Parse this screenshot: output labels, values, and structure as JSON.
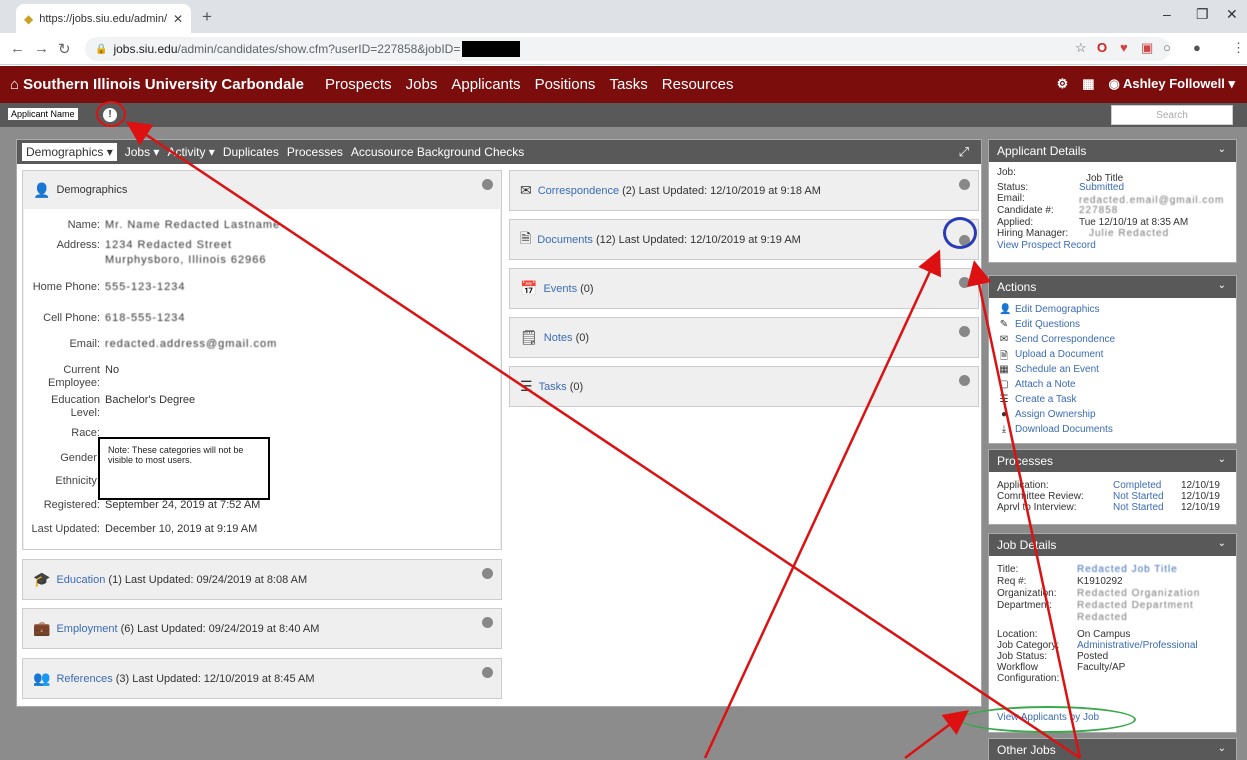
{
  "browser": {
    "tab_title": "https://jobs.siu.edu/admin/candi",
    "url_host": "jobs.siu.edu",
    "url_path": "/admin/candidates/show.cfm?userID=227858&jobID="
  },
  "site": {
    "brand": "Southern Illinois University Carbondale",
    "nav": [
      "Prospects",
      "Jobs",
      "Applicants",
      "Positions",
      "Tasks",
      "Resources"
    ],
    "user": "Ashley Followell"
  },
  "subbar": {
    "applicant_name": "Applicant Name",
    "search_placeholder": "Search"
  },
  "tabs": [
    "Demographics ▾",
    "Jobs ▾",
    "Activity ▾",
    "Duplicates",
    "Processes",
    "Accusource Background Checks"
  ],
  "demographics": {
    "title": "Demographics",
    "labels": {
      "name": "Name:",
      "address": "Address:",
      "home_phone": "Home Phone:",
      "cell_phone": "Cell Phone:",
      "email": "Email:",
      "current_employee": "Current Employee:",
      "education_level": "Education Level:",
      "race": "Race:",
      "gender": "Gender:",
      "ethnicity": "Ethnicity:",
      "registered": "Registered:",
      "last_updated": "Last Updated:"
    },
    "values": {
      "name": "Mr. Name Redacted Lastname",
      "address1": "1234 Redacted Street",
      "address2": "Murphysboro, Illinois 62966",
      "home_phone": "555-123-1234",
      "cell_phone": "618-555-1234",
      "email": "redacted.address@gmail.com",
      "current_employee": "No",
      "education_level": "Bachelor's Degree",
      "registered": "September 24, 2019 at 7:52 AM",
      "last_updated": "December 10, 2019 at 9:19 AM"
    },
    "note": "Note: These categories will not be visible to most users."
  },
  "left_cards": [
    {
      "link": "Education",
      "rest": " (1) Last Updated: 09/24/2019 at 8:08 AM"
    },
    {
      "link": "Employment",
      "rest": " (6) Last Updated: 09/24/2019 at 8:40 AM"
    },
    {
      "link": "References",
      "rest": " (3) Last Updated: 12/10/2019 at 8:45 AM"
    }
  ],
  "right_cards": [
    {
      "link": "Correspondence",
      "rest": " (2) Last Updated: 12/10/2019 at 9:18 AM"
    },
    {
      "link": "Documents",
      "rest": " (12) Last Updated: 12/10/2019 at 9:19 AM"
    },
    {
      "link": "Events",
      "rest": " (0)"
    },
    {
      "link": "Notes",
      "rest": " (0)"
    },
    {
      "link": "Tasks",
      "rest": " (0)"
    }
  ],
  "applicant_details": {
    "title": "Applicant Details",
    "job_label": "Job:",
    "job_value": "Job Title",
    "status_label": "Status:",
    "status_value": "Submitted",
    "email_label": "Email:",
    "email_value": "redacted.email@gmail.com",
    "candidate_label": "Candidate #:",
    "candidate_value": "227858",
    "applied_label": "Applied:",
    "applied_value": "Tue 12/10/19 at 8:35 AM",
    "manager_label": "Hiring Manager:",
    "manager_value": "Julie Redacted",
    "view_prospect": "View Prospect Record"
  },
  "actions": {
    "title": "Actions",
    "items": [
      "Edit Demographics",
      "Edit Questions",
      "Send Correspondence",
      "Upload a Document",
      "Schedule an Event",
      "Attach a Note",
      "Create a Task",
      "Assign Ownership",
      "Download Documents"
    ]
  },
  "processes": {
    "title": "Processes",
    "rows": [
      {
        "name": "Application:",
        "status": "Completed",
        "date": "12/10/19"
      },
      {
        "name": "Committee Review:",
        "status": "Not Started",
        "date": "12/10/19"
      },
      {
        "name": "Aprvl to Interview:",
        "status": "Not Started",
        "date": "12/10/19"
      }
    ]
  },
  "job_details": {
    "title": "Job Details",
    "title_label": "Title:",
    "title_value": "Redacted Job Title",
    "req_label": "Req #:",
    "req_value": "K1910292",
    "org_label": "Organization:",
    "org_value": "Redacted Organization",
    "dept_label": "Department:",
    "dept_value1": "Redacted Department",
    "dept_value2": "Redacted",
    "location_label": "Location:",
    "location_value": "On Campus",
    "category_label": "Job Category:",
    "category_value": "Administrative/Professional",
    "status_label": "Job Status:",
    "status_value": "Posted",
    "workflow_label": "Workflow",
    "workflow_value": "Faculty/AP",
    "config_label": "Configuration:",
    "view_applicants": "View Applicants by Job"
  },
  "other_jobs": {
    "title": "Other Jobs"
  },
  "colors": {
    "brand": "#7b0d0d",
    "bar": "#595959",
    "link": "#3b6bb5",
    "annotation_red": "#dd1111",
    "annotation_blue": "#2a3bb8",
    "annotation_green": "#3aa84c"
  }
}
